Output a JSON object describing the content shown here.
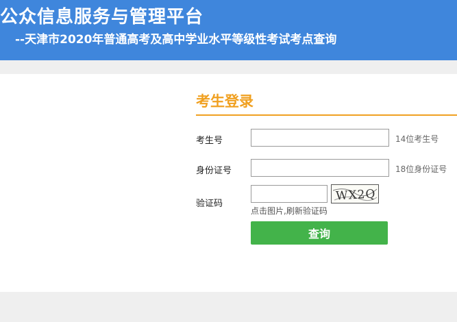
{
  "header": {
    "title": "公众信息服务与管理平台",
    "subtitle": "--天津市2020年普通高考及高中学业水平等级性考试考点查询"
  },
  "login": {
    "title": "考生登录",
    "fields": {
      "exam_number": {
        "label": "考生号",
        "value": "",
        "hint": "14位考生号"
      },
      "id_number": {
        "label": "身份证号",
        "value": "",
        "hint": "18位身份证号"
      },
      "captcha": {
        "label": "验证码",
        "value": "",
        "image_text": "WX2Q",
        "refresh_note": "点击图片,刷新验证码"
      }
    },
    "submit_label": "查询"
  },
  "colors": {
    "header_bg": "#3f86dc",
    "accent": "#f0a020",
    "button": "#43b34a",
    "page_bg": "#efefef"
  }
}
